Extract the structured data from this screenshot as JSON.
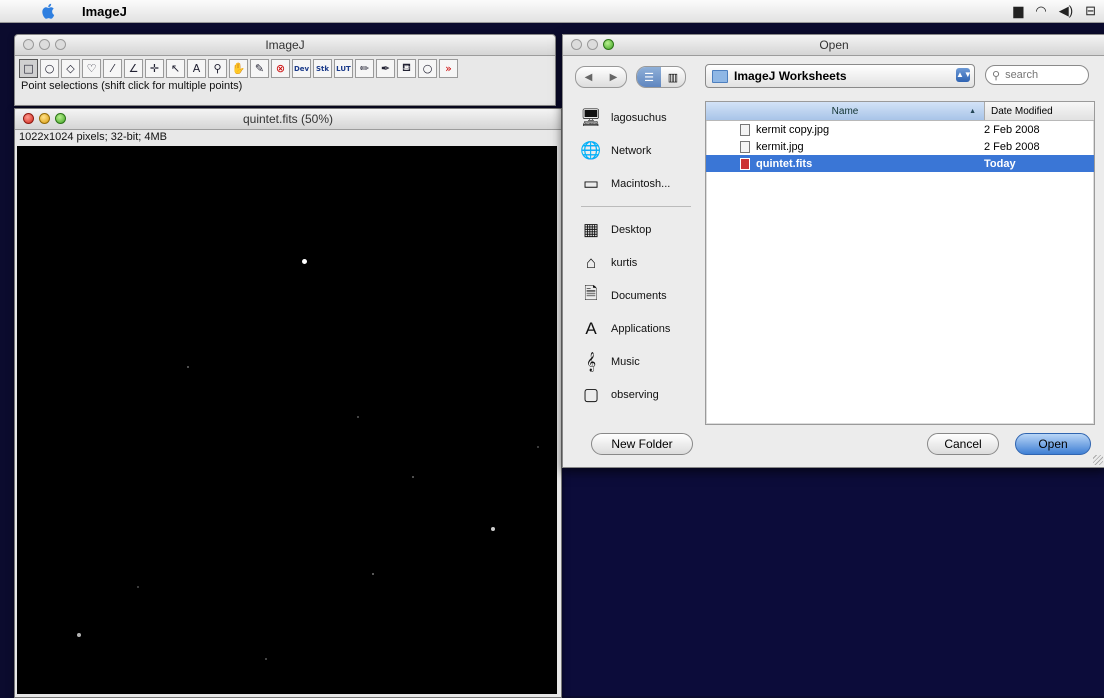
{
  "menubar": {
    "app_name": "ImageJ",
    "extras": [
      "▆",
      "wifi",
      "◀))",
      "⊟"
    ]
  },
  "toolbar_window": {
    "title": "ImageJ",
    "tools": [
      {
        "name": "rectangle-tool-icon",
        "glyph": "□"
      },
      {
        "name": "oval-tool-icon",
        "glyph": "○"
      },
      {
        "name": "polygon-tool-icon",
        "glyph": "◇"
      },
      {
        "name": "freehand-tool-icon",
        "glyph": "♡"
      },
      {
        "name": "line-tool-icon",
        "glyph": "⁄"
      },
      {
        "name": "angle-tool-icon",
        "glyph": "∠"
      },
      {
        "name": "point-tool-icon",
        "glyph": "✛"
      },
      {
        "name": "wand-tool-icon",
        "glyph": "↖"
      },
      {
        "name": "text-tool-icon",
        "glyph": "A"
      },
      {
        "name": "magnifier-tool-icon",
        "glyph": "⚲"
      },
      {
        "name": "hand-tool-icon",
        "glyph": "✋"
      },
      {
        "name": "dropper-tool-icon",
        "glyph": "✎"
      },
      {
        "name": "stop-tool-icon",
        "glyph": "⊗"
      },
      {
        "name": "dev-tool-icon",
        "glyph": "Dev"
      },
      {
        "name": "stk-tool-icon",
        "glyph": "Stk"
      },
      {
        "name": "lut-tool-icon",
        "glyph": "LUT"
      },
      {
        "name": "pencil-tool-icon",
        "glyph": "✏"
      },
      {
        "name": "brush-tool-icon",
        "glyph": "✒"
      },
      {
        "name": "flood-fill-tool-icon",
        "glyph": "⛾"
      },
      {
        "name": "circle-tool-icon",
        "glyph": "○"
      },
      {
        "name": "more-tools-icon",
        "glyph": "»"
      }
    ],
    "status": "Point selections (shift click for multiple points)"
  },
  "image_window": {
    "title": "quintet.fits (50%)",
    "info": "1022x1024 pixels; 32-bit; 4MB"
  },
  "open_dialog": {
    "title": "Open",
    "folder": "ImageJ Worksheets",
    "search_placeholder": "search",
    "sidebar": [
      {
        "label": "lagosuchus",
        "icon": "computer-icon",
        "glyph": "🖥"
      },
      {
        "label": "Network",
        "icon": "network-icon",
        "glyph": "🌐"
      },
      {
        "label": "Macintosh...",
        "icon": "hard-drive-icon",
        "glyph": "▭"
      },
      {
        "label": "Desktop",
        "icon": "desktop-icon",
        "glyph": "▦"
      },
      {
        "label": "kurtis",
        "icon": "home-icon",
        "glyph": "⌂"
      },
      {
        "label": "Documents",
        "icon": "documents-icon",
        "glyph": "🗎"
      },
      {
        "label": "Applications",
        "icon": "applications-icon",
        "glyph": "A"
      },
      {
        "label": "Music",
        "icon": "music-icon",
        "glyph": "𝄞"
      },
      {
        "label": "observing",
        "icon": "folder-icon",
        "glyph": "▢"
      }
    ],
    "columns": {
      "name": "Name",
      "date": "Date Modified"
    },
    "files": [
      {
        "name": "kermit copy.jpg",
        "date": "2 Feb 2008"
      },
      {
        "name": "kermit.jpg",
        "date": "2 Feb 2008"
      },
      {
        "name": "quintet.fits",
        "date": "Today"
      }
    ],
    "new_folder": "New Folder",
    "cancel": "Cancel",
    "open": "Open"
  }
}
